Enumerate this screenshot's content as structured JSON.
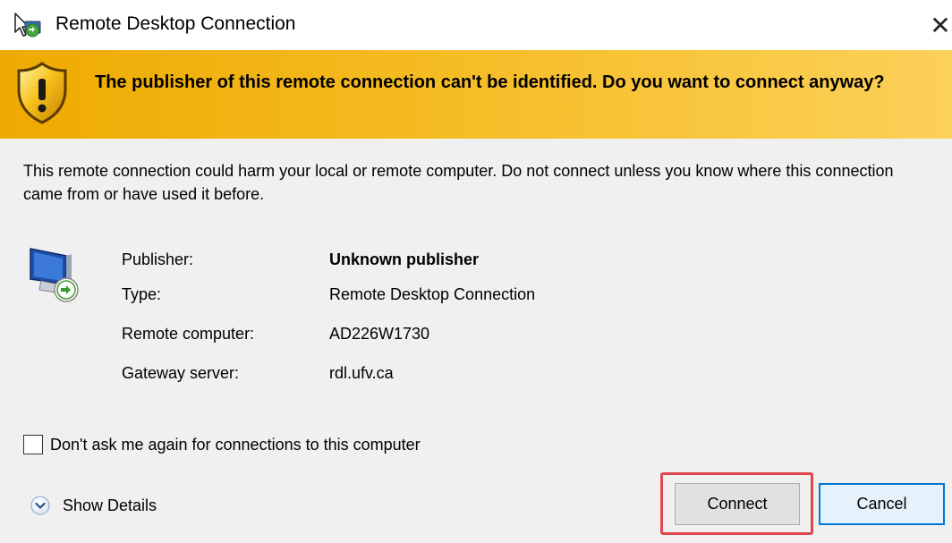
{
  "window": {
    "title": "Remote Desktop Connection",
    "close_glyph": "✕"
  },
  "banner": {
    "message": "The publisher of this remote connection can't be identified. Do you want to connect anyway?",
    "icon": "shield-warning-icon"
  },
  "description": "This remote connection could harm your local or remote computer. Do not connect unless you know where this connection came from or have used it before.",
  "info": {
    "icon": "remote-computer-icon",
    "publisher": {
      "label": "Publisher:",
      "value": "Unknown publisher"
    },
    "type": {
      "label": "Type:",
      "value": "Remote Desktop Connection"
    },
    "remote_computer": {
      "label": "Remote computer:",
      "value": "AD226W1730"
    },
    "gateway_server": {
      "label": "Gateway server:",
      "value": "rdl.ufv.ca"
    }
  },
  "checkbox": {
    "label": "Don't ask me again for connections to this computer",
    "checked": false
  },
  "details": {
    "label": "Show Details",
    "icon": "chevron-down-circle-icon"
  },
  "buttons": {
    "connect": "Connect",
    "cancel": "Cancel"
  },
  "colors": {
    "banner_start": "#eeaa00",
    "banner_end": "#fcd15a",
    "highlight": "#e0474c",
    "default_button_border": "#0078d7"
  }
}
